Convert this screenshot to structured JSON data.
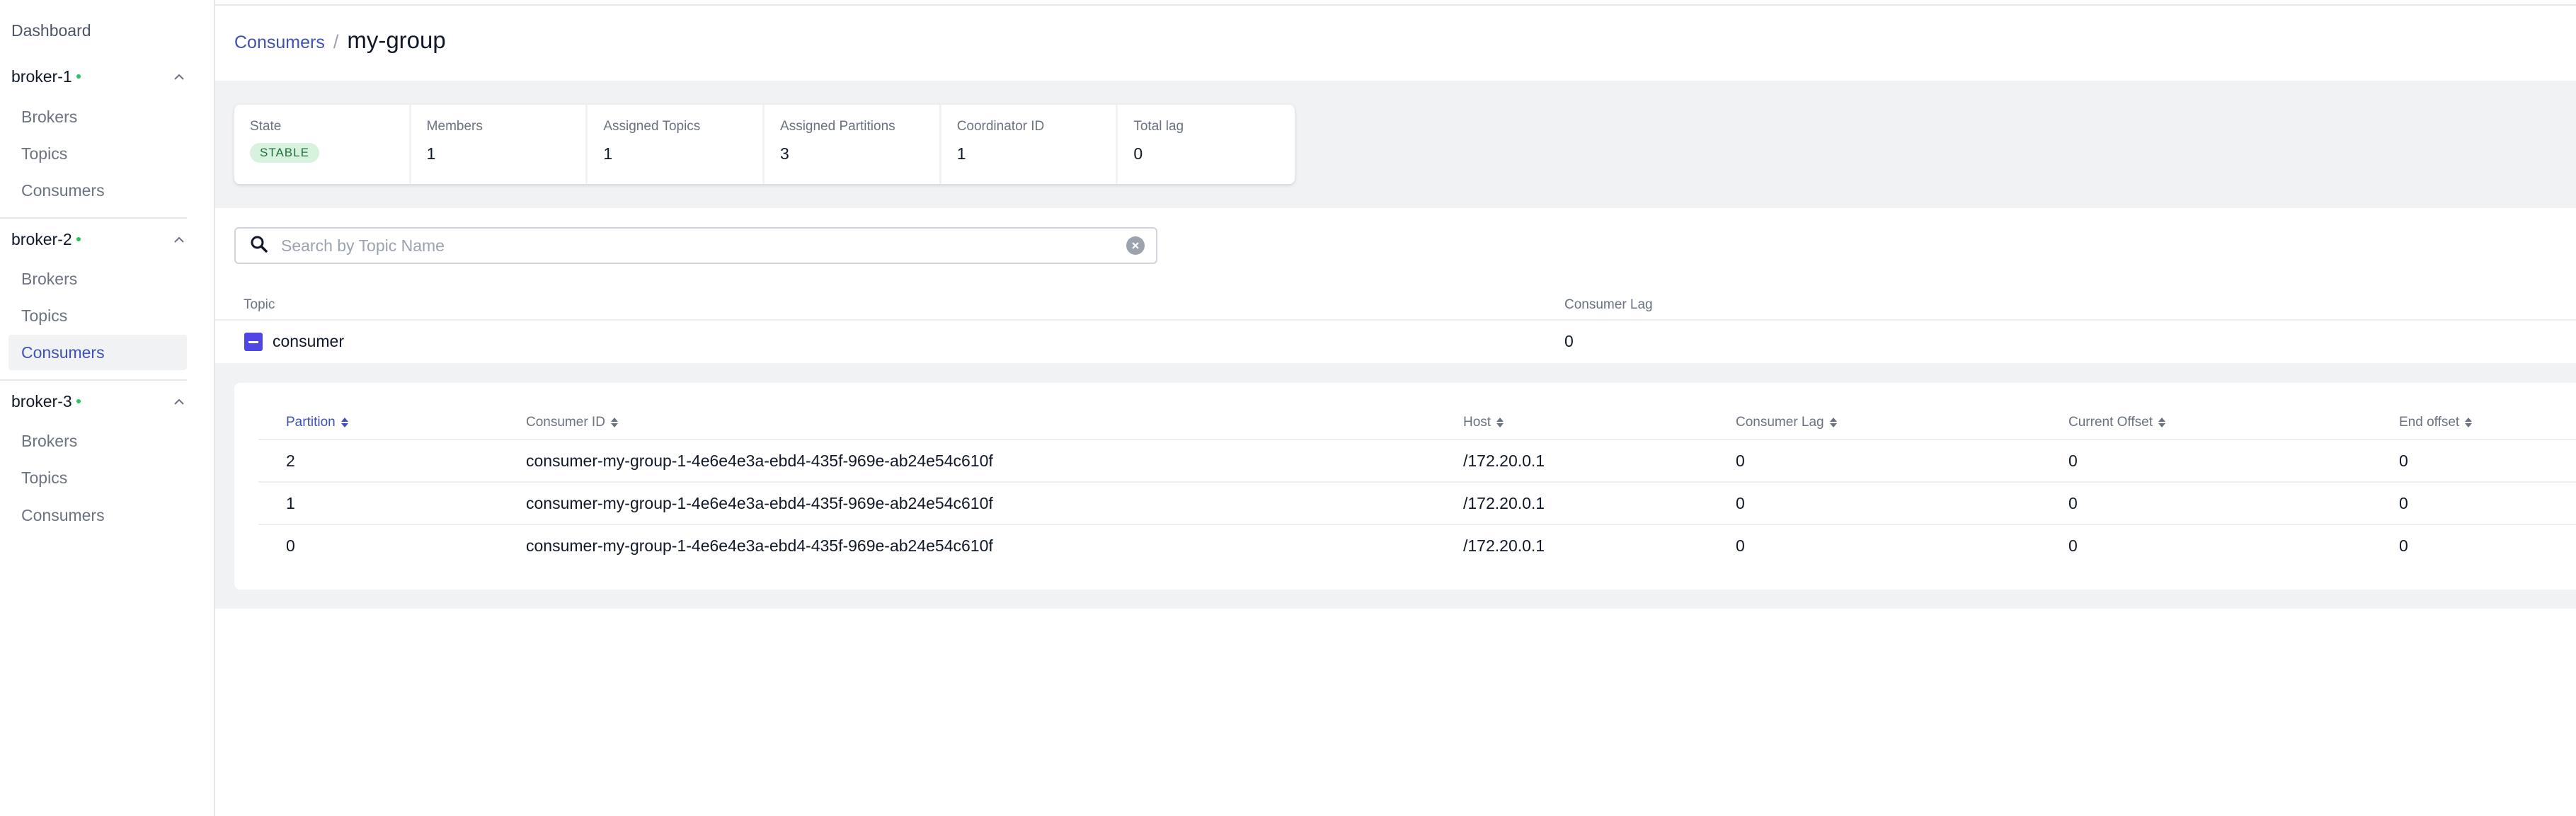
{
  "sidebar": {
    "dashboard": "Dashboard",
    "groups": [
      {
        "name": "broker-1",
        "items": [
          "Brokers",
          "Topics",
          "Consumers"
        ]
      },
      {
        "name": "broker-2",
        "items": [
          "Brokers",
          "Topics",
          "Consumers"
        ]
      },
      {
        "name": "broker-3",
        "items": [
          "Brokers",
          "Topics",
          "Consumers"
        ]
      }
    ],
    "active_group": "broker-2",
    "active_item": "Consumers",
    "status_dot_color": "#22c55e"
  },
  "breadcrumb": {
    "parent": "Consumers",
    "separator": "/",
    "current": "my-group"
  },
  "metrics": [
    {
      "label": "State",
      "value": "STABLE"
    },
    {
      "label": "Members",
      "value": "1"
    },
    {
      "label": "Assigned Topics",
      "value": "1"
    },
    {
      "label": "Assigned Partitions",
      "value": "3"
    },
    {
      "label": "Coordinator ID",
      "value": "1"
    },
    {
      "label": "Total lag",
      "value": "0"
    }
  ],
  "search": {
    "placeholder": "Search by Topic Name"
  },
  "topics_table": {
    "headers": [
      "Topic",
      "Consumer Lag"
    ],
    "rows": [
      {
        "topic": "consumer",
        "lag": "0"
      }
    ]
  },
  "partitions_table": {
    "headers": [
      "Partition",
      "Consumer ID",
      "Host",
      "Consumer Lag",
      "Current Offset",
      "End offset"
    ],
    "rows": [
      [
        "2",
        "consumer-my-group-1-4e6e4e3a-ebd4-435f-969e-ab24e54c610f",
        "/172.20.0.1",
        "0",
        "0",
        "0"
      ],
      [
        "1",
        "consumer-my-group-1-4e6e4e3a-ebd4-435f-969e-ab24e54c610f",
        "/172.20.0.1",
        "0",
        "0",
        "0"
      ],
      [
        "0",
        "consumer-my-group-1-4e6e4e3a-ebd4-435f-969e-ab24e54c610f",
        "/172.20.0.1",
        "0",
        "0",
        "0"
      ]
    ]
  },
  "colors": {
    "accent": "#3f51b5",
    "checkbox": "#4f46e5",
    "badge_bg": "#d7f3df",
    "badge_text": "#1f6f3a"
  }
}
